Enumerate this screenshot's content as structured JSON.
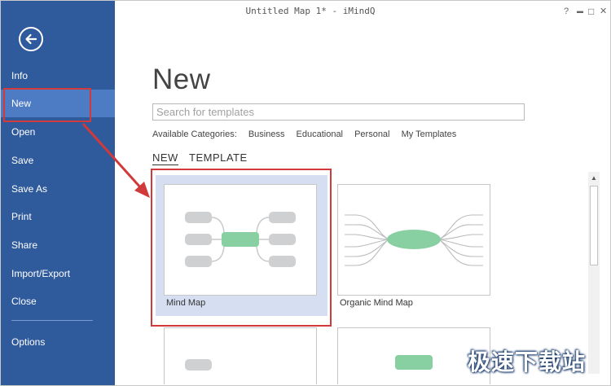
{
  "window": {
    "title": "Untitled Map 1* - iMindQ",
    "controls": [
      "?",
      "▬",
      "□",
      "✕"
    ]
  },
  "sidebar": {
    "back_icon": "back-arrow-icon",
    "items": [
      {
        "label": "Info"
      },
      {
        "label": "New",
        "active": true
      },
      {
        "label": "Open"
      },
      {
        "label": "Save"
      },
      {
        "label": "Save As"
      },
      {
        "label": "Print"
      },
      {
        "label": "Share"
      },
      {
        "label": "Import/Export"
      },
      {
        "label": "Close"
      },
      {
        "label": "Options"
      }
    ]
  },
  "main": {
    "heading": "New",
    "search": {
      "placeholder": "Search for templates",
      "value": ""
    },
    "categories": {
      "label": "Available Categories:",
      "items": [
        "Business",
        "Educational",
        "Personal",
        "My Templates"
      ]
    },
    "tabs": [
      {
        "label": "NEW",
        "active": true
      },
      {
        "label": "TEMPLATE",
        "active": false
      }
    ],
    "templates": [
      {
        "label": "Mind Map",
        "selected": true
      },
      {
        "label": "Organic Mind Map",
        "selected": false
      },
      {
        "label": "",
        "selected": false
      },
      {
        "label": "",
        "selected": false
      }
    ]
  },
  "colors": {
    "sidebar": "#2f5a9c",
    "sidebar_active": "#4d7bc4",
    "selection": "#d6dff1",
    "annotation": "#d03a3a",
    "topic_green": "#88cfa2",
    "topic_grey": "#cfd0d1"
  },
  "watermark": "极速下载站"
}
